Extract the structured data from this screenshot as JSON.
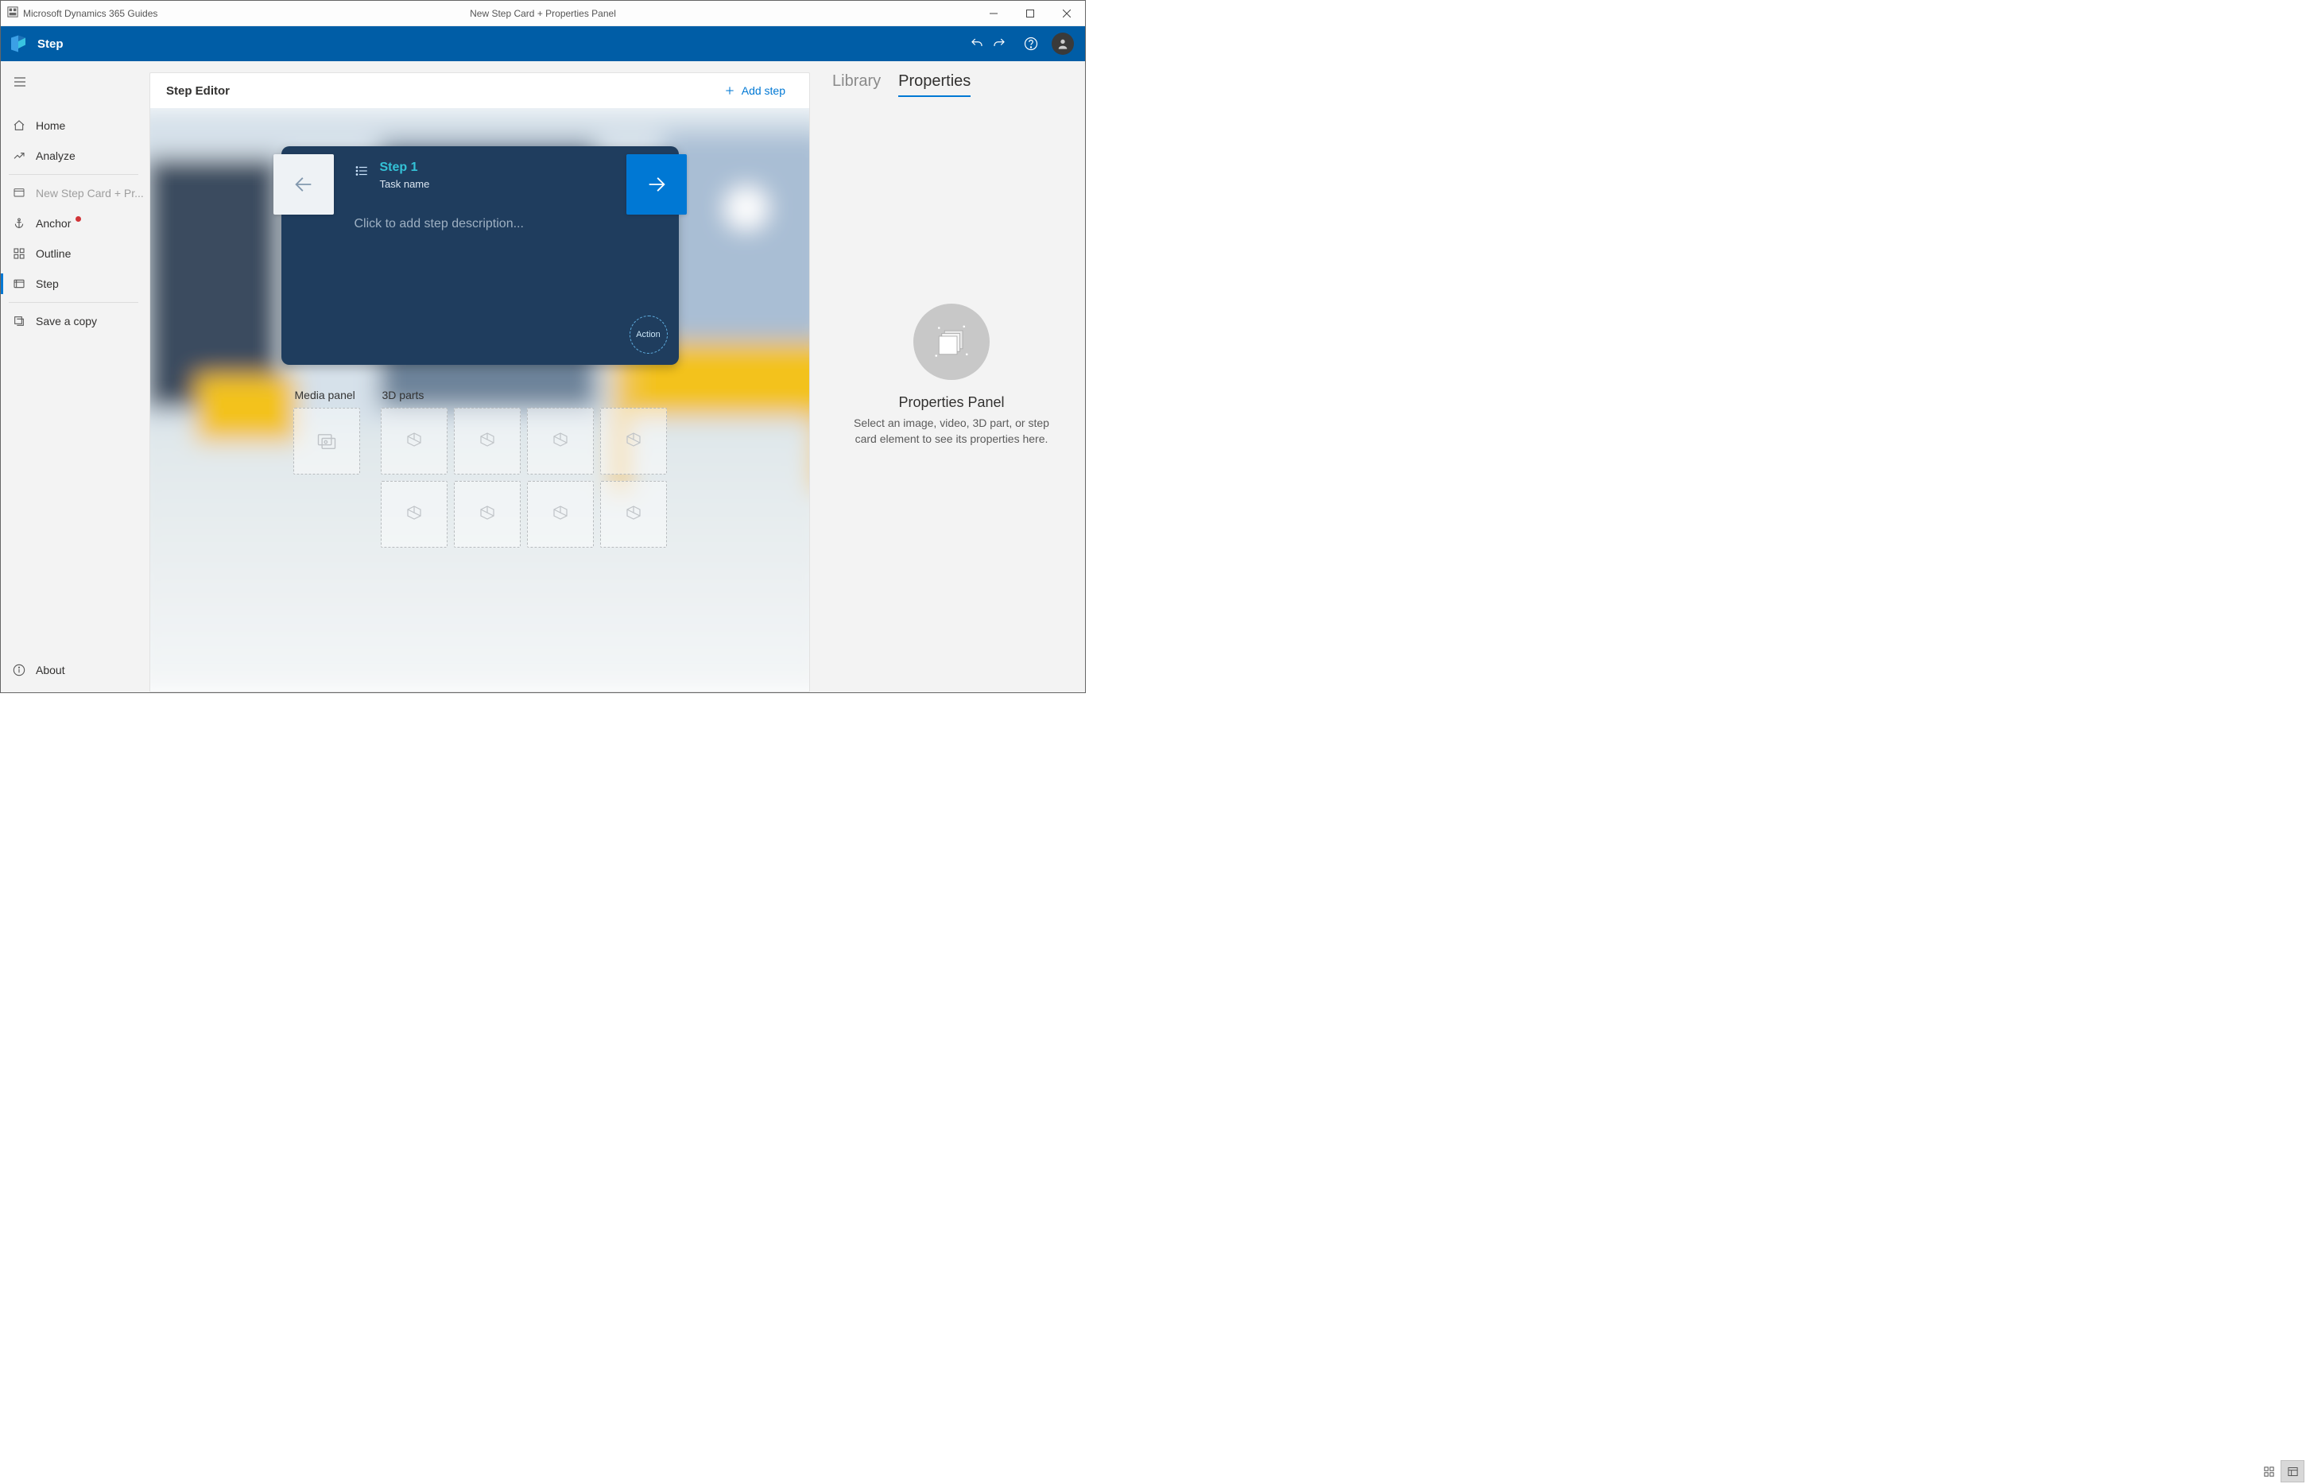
{
  "titlebar": {
    "app_name": "Microsoft Dynamics 365 Guides",
    "doc_title": "New Step Card + Properties Panel"
  },
  "appbar": {
    "breadcrumb": "Step"
  },
  "sidebar": {
    "nav_home": "Home",
    "nav_analyze": "Analyze",
    "nav_guide": "New Step Card + Pr...",
    "nav_anchor": "Anchor",
    "nav_outline": "Outline",
    "nav_step": "Step",
    "nav_save_copy": "Save a copy",
    "nav_about": "About"
  },
  "editor": {
    "title": "Step Editor",
    "add_step": "Add step",
    "step_title": "Step 1",
    "task_name": "Task name",
    "desc_placeholder": "Click to add step description...",
    "action": "Action",
    "media_panel_label": "Media panel",
    "parts_label": "3D parts"
  },
  "rightpanel": {
    "tab_library": "Library",
    "tab_properties": "Properties",
    "empty_title": "Properties Panel",
    "empty_desc": "Select an image, video, 3D part, or step card element to see its properties here."
  }
}
